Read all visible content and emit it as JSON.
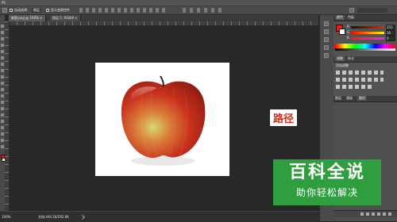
{
  "menubar": {
    "items": [
      "PS",
      "文件",
      "编辑",
      "图像",
      "图层",
      "类型",
      "选择",
      "滤镜",
      "3D",
      "视图",
      "窗口",
      "帮助"
    ]
  },
  "options": {
    "auto_select": "自动选择:",
    "layer": "图层",
    "transform": "显示变换控件"
  },
  "tabs": [
    {
      "label": "新图.png @ 100%"
    },
    {
      "label": "图层 0, RGB/8"
    }
  ],
  "status": {
    "zoom": "100%",
    "doc": "文档:444.1K/592.8K"
  },
  "panels": {
    "color_tab": "颜色",
    "swatches_tab": "色板",
    "r_label": "R",
    "r_value": "255",
    "g_label": "G",
    "g_value": "30",
    "b_label": "B",
    "b_value": "0",
    "adjust_tab": "调整",
    "styles_tab": "样式",
    "adjust_title": "添加调整",
    "layers_tab": "图层",
    "channels_tab": "通道",
    "paths_tab": "路径"
  },
  "overlay_label": "路径",
  "watermark": {
    "title": "百科全说",
    "subtitle": "助你轻松解决"
  },
  "colors": {
    "foreground": "#e0241a",
    "background": "#ffffff",
    "accent_red": "#d92b1d",
    "watermark_green": "#2f9e3f"
  }
}
